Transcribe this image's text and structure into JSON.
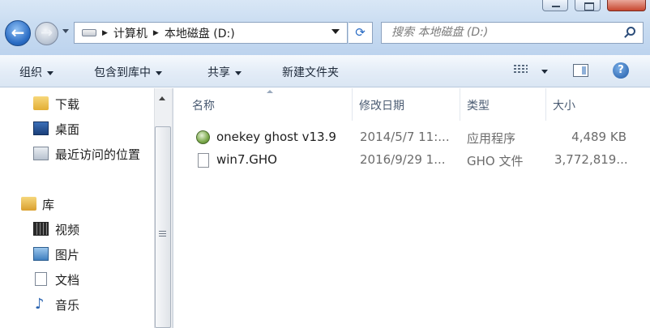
{
  "window": {
    "controls": {
      "minimize": "minimize",
      "maximize": "maximize",
      "close": "close"
    }
  },
  "nav_buttons": {
    "back": "←",
    "forward": "→"
  },
  "address": {
    "crumbs": [
      "计算机",
      "本地磁盘 (D:)"
    ],
    "separator": "▶"
  },
  "search": {
    "placeholder": "搜索 本地磁盘 (D:)"
  },
  "toolbar": {
    "organize": "组织",
    "include_in_library": "包含到库中",
    "share": "共享",
    "new_folder": "新建文件夹"
  },
  "icons": {
    "help": "?"
  },
  "nav_pane": {
    "favorites": [
      {
        "label": "下载",
        "icon": "download-folder-icon"
      },
      {
        "label": "桌面",
        "icon": "desktop-icon"
      },
      {
        "label": "最近访问的位置",
        "icon": "recent-places-icon"
      }
    ],
    "libraries_header": "库",
    "libraries": [
      {
        "label": "视频",
        "icon": "video-icon"
      },
      {
        "label": "图片",
        "icon": "pictures-icon"
      },
      {
        "label": "文档",
        "icon": "documents-icon"
      },
      {
        "label": "音乐",
        "icon": "music-icon"
      }
    ]
  },
  "file_list": {
    "columns": [
      "名称",
      "修改日期",
      "类型",
      "大小"
    ],
    "rows": [
      {
        "name": "onekey ghost v13.9",
        "date": "2014/5/7 11:...",
        "type": "应用程序",
        "size": "4,489 KB",
        "icon": "ghost-app-icon"
      },
      {
        "name": "win7.GHO",
        "date": "2016/9/29 1...",
        "type": "GHO 文件",
        "size": "3,772,819...",
        "icon": "file-icon"
      }
    ]
  }
}
